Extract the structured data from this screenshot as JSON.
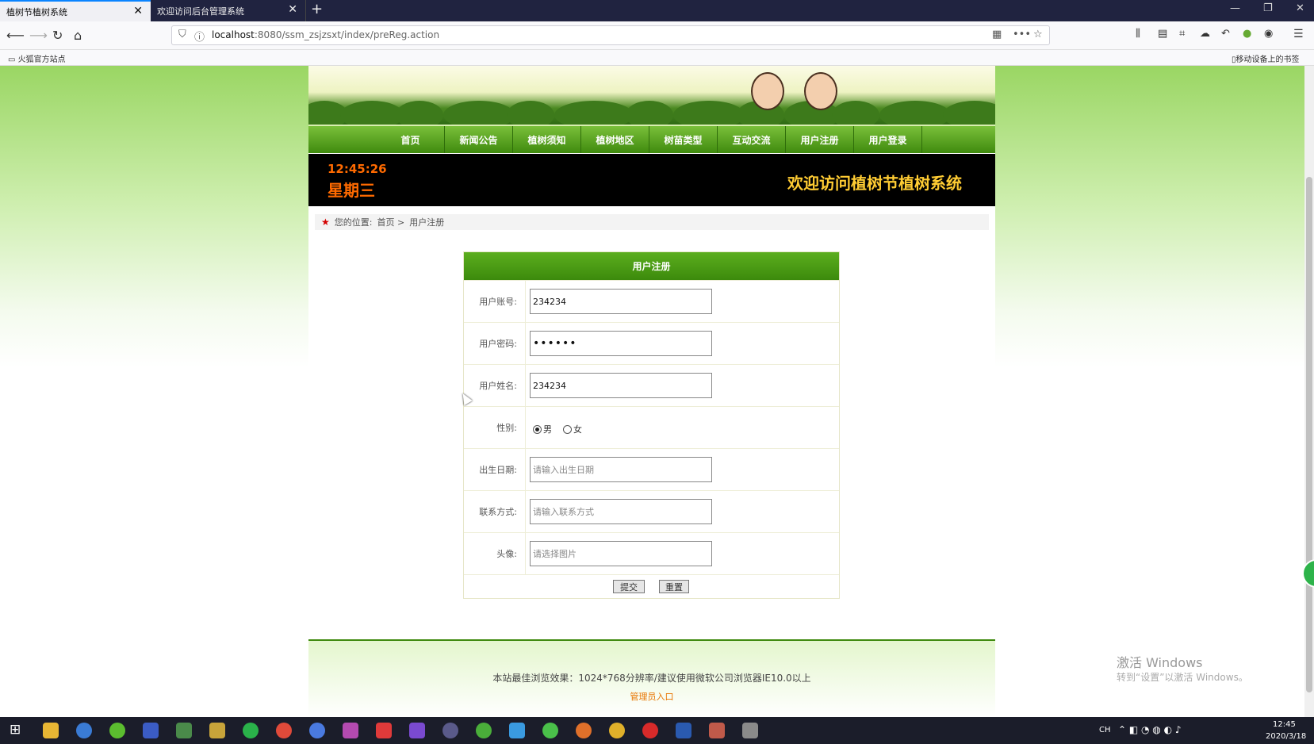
{
  "browser": {
    "tabs": [
      {
        "title": "植树节植树系统",
        "active": true
      },
      {
        "title": "欢迎访问后台管理系统",
        "active": false
      }
    ],
    "new_tab_icon": "+",
    "url_host": "localhost",
    "url_rest": ":8080/ssm_zsjzsxt/index/preReg.action",
    "bookmark_left": "火狐官方站点",
    "bookmark_right": "移动设备上的书签"
  },
  "site": {
    "menu": [
      "首页",
      "新闻公告",
      "植树须知",
      "植树地区",
      "树苗类型",
      "互动交流",
      "用户注册",
      "用户登录"
    ],
    "clock": "12:45:26",
    "weekday": "星期三",
    "welcome": "欢迎访问植树节植树系统",
    "breadcrumb": {
      "prefix": "您的位置:",
      "home": "首页 >",
      "current": "用户注册"
    }
  },
  "form": {
    "title": "用户注册",
    "account_label": "用户账号:",
    "account_value": "234234",
    "password_label": "用户密码:",
    "password_value": "••••••",
    "name_label": "用户姓名:",
    "name_value": "234234",
    "gender_label": "性别:",
    "gender_male": "男",
    "gender_female": "女",
    "gender_selected": "男",
    "birth_label": "出生日期:",
    "birth_placeholder": "请输入出生日期",
    "contact_label": "联系方式:",
    "contact_placeholder": "请输入联系方式",
    "avatar_label": "头像:",
    "avatar_placeholder": "请选择图片",
    "submit": "提交",
    "reset": "重置"
  },
  "footer": {
    "note": "本站最佳浏览效果：1024*768分辨率/建议使用微软公司浏览器IE10.0以上",
    "admin_link": "管理员入口"
  },
  "watermark": {
    "line1": "激活 Windows",
    "line2": "转到“设置”以激活 Windows。"
  },
  "taskbar": {
    "time": "12:45",
    "date": "2020/3/18",
    "lang": "CH"
  }
}
